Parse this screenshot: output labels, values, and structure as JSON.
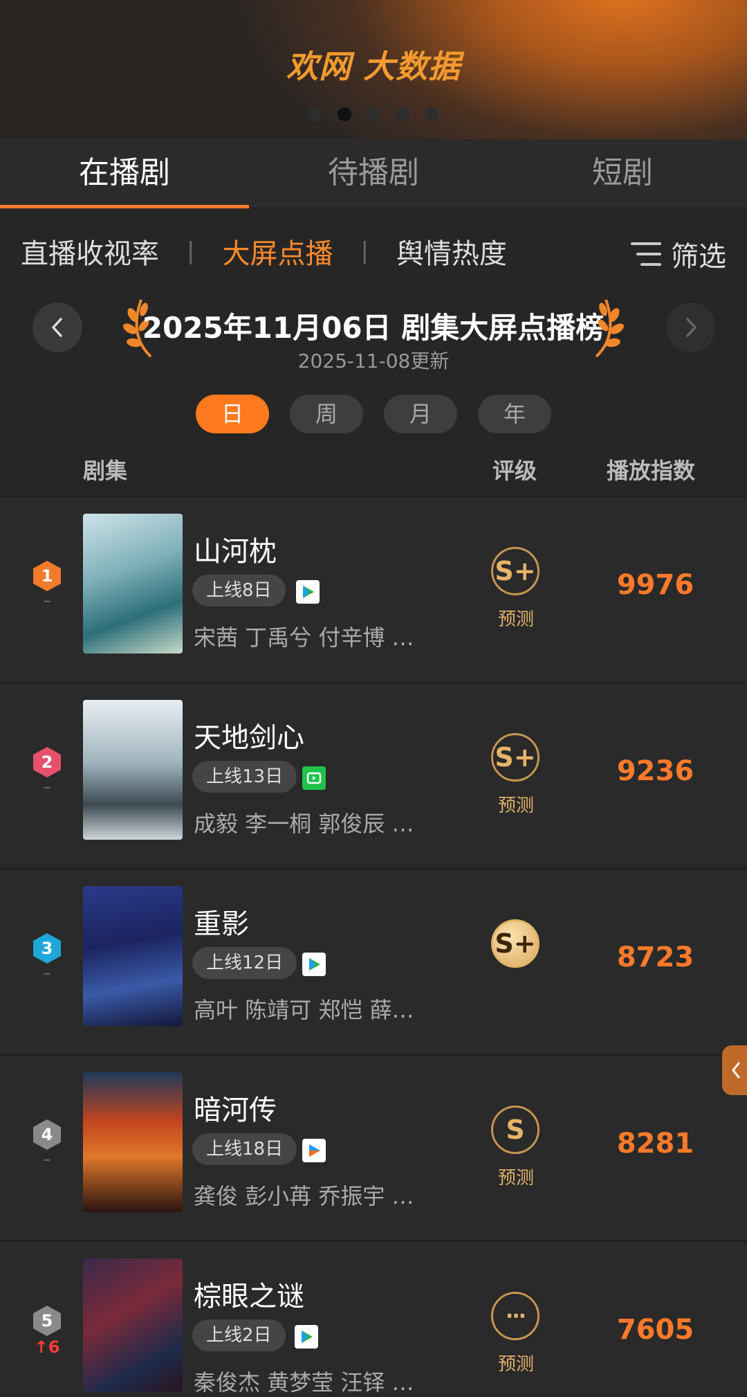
{
  "banner": {
    "logo_text": "欢网 大数据",
    "dots": 5,
    "active_dot": 1
  },
  "tabs": [
    {
      "label": "在播剧",
      "active": true
    },
    {
      "label": "待播剧",
      "active": false
    },
    {
      "label": "短剧",
      "active": false
    }
  ],
  "subtabs": [
    {
      "label": "直播收视率",
      "active": false
    },
    {
      "label": "大屏点播",
      "active": true
    },
    {
      "label": "舆情热度",
      "active": false
    }
  ],
  "filter_label": "筛选",
  "ranking": {
    "title": "2025年11月06日 剧集大屏点播榜",
    "updated": "2025-11-08更新"
  },
  "periods": [
    {
      "label": "日",
      "active": true
    },
    {
      "label": "周",
      "active": false
    },
    {
      "label": "月",
      "active": false
    },
    {
      "label": "年",
      "active": false
    }
  ],
  "table_header": {
    "series": "剧集",
    "grade": "评级",
    "index": "播放指数"
  },
  "rows": [
    {
      "rank": "1",
      "change": "–",
      "name": "山河枕",
      "days": "上线8日",
      "platform": "tencent-video-icon",
      "cast": "宋茜 丁禹兮 付辛博 …",
      "grade": "S+",
      "grade_label": "预测",
      "score": "9976"
    },
    {
      "rank": "2",
      "change": "–",
      "name": "天地剑心",
      "days": "上线13日",
      "platform": "iqiyi-icon",
      "cast": "成毅 李一桐 郭俊辰 …",
      "grade": "S+",
      "grade_label": "预测",
      "score": "9236"
    },
    {
      "rank": "3",
      "change": "–",
      "name": "重影",
      "days": "上线12日",
      "platform": "tencent-video-icon",
      "cast": "高叶 陈靖可 郑恺 薛…",
      "grade": "S+",
      "grade_label": "",
      "score": "8723"
    },
    {
      "rank": "4",
      "change": "–",
      "name": "暗河传",
      "days": "上线18日",
      "platform": "youku-icon",
      "cast": "龚俊 彭小苒 乔振宇 …",
      "grade": "S",
      "grade_label": "预测",
      "score": "8281"
    },
    {
      "rank": "5",
      "change": "↑6",
      "name": "棕眼之谜",
      "days": "上线2日",
      "platform": "tencent-video-icon",
      "cast": "秦俊杰 黄梦莹 汪铎 …",
      "grade": "···",
      "grade_label": "预测",
      "score": "7605"
    }
  ],
  "colors": {
    "accent": "#ff7a2a",
    "rank1": "#f07b2b",
    "rank2": "#e5506b",
    "rank3": "#1fa7d8",
    "rank_other": "#8a8a8a"
  }
}
